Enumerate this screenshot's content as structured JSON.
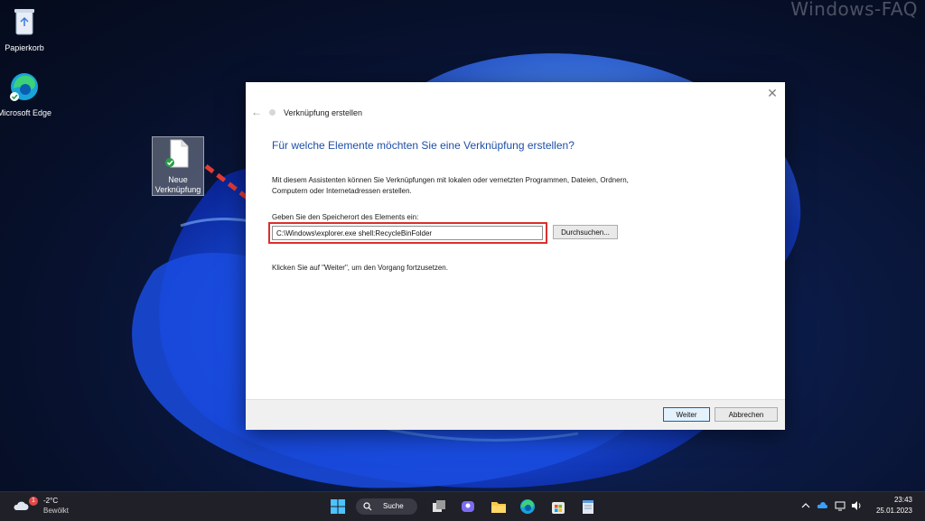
{
  "watermark": "Windows-FAQ",
  "desktop": {
    "icons": [
      {
        "label": "Papierkorb",
        "icon": "recycle-bin-icon"
      },
      {
        "label": "Microsoft Edge",
        "icon": "edge-icon"
      },
      {
        "label": "Neue Verknüpfung",
        "icon": "new-shortcut-file-icon"
      }
    ]
  },
  "dialog": {
    "window_title": "Verknüpfung erstellen",
    "heading": "Für welche Elemente möchten Sie eine Verknüpfung erstellen?",
    "description": "Mit diesem Assistenten können Sie Verknüpfungen mit lokalen oder vernetzten Programmen, Dateien, Ordnern, Computern oder Internetadressen erstellen.",
    "location_label": "Geben Sie den Speicherort des Elements ein:",
    "location_value": "C:\\Windows\\explorer.exe shell:RecycleBinFolder",
    "browse_label": "Durchsuchen...",
    "hint": "Klicken Sie auf \"Weiter\", um den Vorgang fortzusetzen.",
    "next_label": "Weiter",
    "cancel_label": "Abbrechen",
    "highlight_color": "#d9302c"
  },
  "taskbar": {
    "weather": {
      "badge": "1",
      "temperature": "-2°C",
      "condition": "Bewölkt"
    },
    "search_label": "Suche",
    "pinned": [
      "start-icon",
      "search-icon",
      "task-view-icon",
      "chat-icon",
      "file-explorer-icon",
      "edge-icon",
      "store-icon",
      "notepad-icon"
    ],
    "tray": [
      "chevron-up-icon",
      "onedrive-icon",
      "display-icon",
      "speaker-icon"
    ],
    "time": "23:43",
    "date": "25.01.2023"
  },
  "colors": {
    "accent": "#1e4fa8",
    "taskbar": "#202028"
  }
}
